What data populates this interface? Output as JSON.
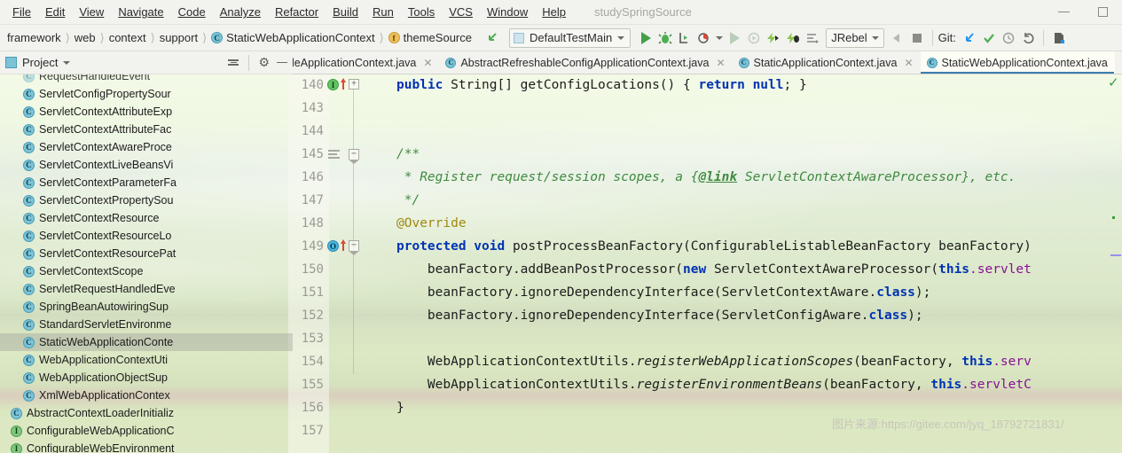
{
  "window": {
    "title": "studySpringSource",
    "minimize_icon": "minimize-icon",
    "maximize_icon": "maximize-icon"
  },
  "menubar": {
    "items": [
      {
        "label": "File"
      },
      {
        "label": "Edit"
      },
      {
        "label": "View"
      },
      {
        "label": "Navigate"
      },
      {
        "label": "Code"
      },
      {
        "label": "Analyze"
      },
      {
        "label": "Refactor"
      },
      {
        "label": "Build"
      },
      {
        "label": "Run"
      },
      {
        "label": "Tools"
      },
      {
        "label": "VCS"
      },
      {
        "label": "Window"
      },
      {
        "label": "Help"
      }
    ]
  },
  "breadcrumbs": {
    "items": [
      {
        "label": "framework",
        "icon": ""
      },
      {
        "label": "web",
        "icon": ""
      },
      {
        "label": "context",
        "icon": ""
      },
      {
        "label": "support",
        "icon": ""
      },
      {
        "label": "StaticWebApplicationContext",
        "icon": "class-icon",
        "glyph": "C"
      },
      {
        "label": "themeSource",
        "icon": "field-icon",
        "glyph": "f"
      }
    ],
    "separator": "〉"
  },
  "toolbar": {
    "back_icon": "back-arrow-icon",
    "run_config": {
      "label": "DefaultTestMain",
      "chip_icon": "run-config-icon",
      "caret_icon": "chevron-down-icon"
    },
    "run_icon": "run-icon",
    "debug_icon": "debug-icon",
    "run_coverage_icon": "run-with-coverage-icon",
    "profile_icon": "profile-icon",
    "profile_caret_icon": "chevron-down-icon",
    "rerun_icon": "rerun-icon",
    "attach_icon": "attach-debugger-icon",
    "jrebel_run_icon": "jrebel-run-icon",
    "jrebel_debug_icon": "jrebel-debug-icon",
    "jrebel_console_icon": "jrebel-console-icon",
    "jrebel": {
      "label": "JRebel",
      "caret_icon": "chevron-down-icon"
    },
    "stop_gradient_icon": "stop-soft-icon",
    "stop_icon": "stop-icon",
    "git": {
      "label": "Git:",
      "update_icon": "update-project-icon",
      "commit_icon": "commit-icon",
      "history_icon": "history-icon",
      "rollback_icon": "rollback-icon",
      "branch_icon": "branch-icon"
    }
  },
  "editor_tabs": [
    {
      "label": "leApplicationContext.java",
      "icon": "class-icon",
      "glyph": "C",
      "active": false,
      "close_icon": "close-icon"
    },
    {
      "label": "AbstractRefreshableConfigApplicationContext.java",
      "icon": "class-icon",
      "glyph": "C",
      "active": false,
      "close_icon": "close-icon"
    },
    {
      "label": "StaticApplicationContext.java",
      "icon": "class-icon",
      "glyph": "C",
      "active": false,
      "close_icon": "close-icon"
    },
    {
      "label": "StaticWebApplicationContext.java",
      "icon": "class-icon",
      "glyph": "C",
      "active": true,
      "close_icon": "close-icon"
    }
  ],
  "project_panel": {
    "title": "Project",
    "caret_icon": "chevron-down-icon",
    "panel_icon": "project-panel-icon",
    "collapse_all_icon": "collapse-all-icon",
    "settings_icon": "gear-icon",
    "hide_icon": "hide-panel-icon",
    "tree": [
      {
        "label": "RequestHandledEvent",
        "kind": "class",
        "glyph": "C",
        "selected": false,
        "partial": true
      },
      {
        "label": "ServletConfigPropertySour",
        "kind": "class",
        "glyph": "C",
        "selected": false
      },
      {
        "label": "ServletContextAttributeExp",
        "kind": "class",
        "glyph": "C",
        "selected": false
      },
      {
        "label": "ServletContextAttributeFac",
        "kind": "class",
        "glyph": "C",
        "selected": false
      },
      {
        "label": "ServletContextAwareProce",
        "kind": "class",
        "glyph": "C",
        "selected": false
      },
      {
        "label": "ServletContextLiveBeansVi",
        "kind": "class",
        "glyph": "C",
        "selected": false
      },
      {
        "label": "ServletContextParameterFa",
        "kind": "class",
        "glyph": "C",
        "selected": false
      },
      {
        "label": "ServletContextPropertySou",
        "kind": "class",
        "glyph": "C",
        "selected": false
      },
      {
        "label": "ServletContextResource",
        "kind": "class",
        "glyph": "C",
        "selected": false
      },
      {
        "label": "ServletContextResourceLo",
        "kind": "class",
        "glyph": "C",
        "selected": false
      },
      {
        "label": "ServletContextResourcePat",
        "kind": "class",
        "glyph": "C",
        "selected": false
      },
      {
        "label": "ServletContextScope",
        "kind": "class",
        "glyph": "C",
        "selected": false
      },
      {
        "label": "ServletRequestHandledEve",
        "kind": "class",
        "glyph": "C",
        "selected": false
      },
      {
        "label": "SpringBeanAutowiringSup",
        "kind": "class",
        "glyph": "C",
        "selected": false
      },
      {
        "label": "StandardServletEnvironme",
        "kind": "class",
        "glyph": "C",
        "selected": false
      },
      {
        "label": "StaticWebApplicationConte",
        "kind": "class",
        "glyph": "C",
        "selected": true
      },
      {
        "label": "WebApplicationContextUti",
        "kind": "class",
        "glyph": "C",
        "selected": false
      },
      {
        "label": "WebApplicationObjectSup",
        "kind": "class",
        "glyph": "C",
        "selected": false
      },
      {
        "label": "XmlWebApplicationContex",
        "kind": "class",
        "glyph": "C",
        "selected": false
      },
      {
        "label": "AbstractContextLoaderInitializ",
        "kind": "class",
        "glyph": "C",
        "selected": false,
        "outdent": true
      },
      {
        "label": "ConfigurableWebApplicationC",
        "kind": "interface",
        "glyph": "I",
        "selected": false,
        "outdent": true
      },
      {
        "label": "ConfigurableWebEnvironment",
        "kind": "interface",
        "glyph": "I",
        "selected": false,
        "outdent": true
      }
    ]
  },
  "editor": {
    "line_numbers": [
      "140",
      "143",
      "144",
      "145",
      "146",
      "147",
      "148",
      "149",
      "150",
      "151",
      "152",
      "153",
      "154",
      "155",
      "156",
      "157"
    ],
    "gutter_markers": [
      {
        "line": "140",
        "icon": "implementing-method-icon",
        "glyph": "I",
        "arrow_icon": "up-arrow-icon"
      },
      {
        "line": "149",
        "icon": "overriding-method-icon",
        "glyph": "O",
        "arrow_icon": "up-arrow-icon"
      },
      {
        "line": "145",
        "icon": "javadoc-icon"
      }
    ],
    "fold_handles": [
      {
        "line": "140",
        "state": "collapsed",
        "glyph": "+"
      },
      {
        "line": "145",
        "state": "expanded",
        "glyph": "−"
      },
      {
        "line": "149",
        "state": "expanded",
        "glyph": "−"
      }
    ],
    "lines": [
      {
        "num": "140",
        "segments": [
          {
            "t": "public ",
            "c": "k"
          },
          {
            "t": "String[] getConfigLocations() { ",
            "c": ""
          },
          {
            "t": "return ",
            "c": "k"
          },
          {
            "t": "null",
            "c": "k"
          },
          {
            "t": "; }",
            "c": ""
          }
        ]
      },
      {
        "num": "143",
        "segments": []
      },
      {
        "num": "144",
        "segments": []
      },
      {
        "num": "145",
        "segments": [
          {
            "t": "/**",
            "c": "cm"
          }
        ]
      },
      {
        "num": "146",
        "segments": [
          {
            "t": " * Register request/session scopes, a {",
            "c": "cm"
          },
          {
            "t": "@link",
            "c": "lnk"
          },
          {
            "t": " ServletContextAwareProcessor}, etc.",
            "c": "cm"
          }
        ]
      },
      {
        "num": "147",
        "segments": [
          {
            "t": " */",
            "c": "cm"
          }
        ]
      },
      {
        "num": "148",
        "segments": [
          {
            "t": "@Override",
            "c": "ann"
          }
        ]
      },
      {
        "num": "149",
        "segments": [
          {
            "t": "protected void ",
            "c": "k"
          },
          {
            "t": "postProcessBeanFactory(ConfigurableListableBeanFactory beanFactory)",
            "c": ""
          }
        ]
      },
      {
        "num": "150",
        "segments": [
          {
            "t": "    beanFactory.addBeanPostProcessor(",
            "c": ""
          },
          {
            "t": "new ",
            "c": "k"
          },
          {
            "t": "ServletContextAwareProcessor(",
            "c": ""
          },
          {
            "t": "this",
            "c": "k"
          },
          {
            "t": ".servlet",
            "c": "fld"
          }
        ]
      },
      {
        "num": "151",
        "segments": [
          {
            "t": "    beanFactory.ignoreDependencyInterface(ServletContextAware.",
            "c": ""
          },
          {
            "t": "class",
            "c": "k"
          },
          {
            "t": ");",
            "c": ""
          }
        ]
      },
      {
        "num": "152",
        "segments": [
          {
            "t": "    beanFactory.ignoreDependencyInterface(ServletConfigAware.",
            "c": ""
          },
          {
            "t": "class",
            "c": "k"
          },
          {
            "t": ");",
            "c": ""
          }
        ]
      },
      {
        "num": "153",
        "segments": []
      },
      {
        "num": "154",
        "segments": [
          {
            "t": "    WebApplicationContextUtils.",
            "c": ""
          },
          {
            "t": "registerWebApplicationScopes",
            "c": "st"
          },
          {
            "t": "(beanFactory, ",
            "c": ""
          },
          {
            "t": "this",
            "c": "k"
          },
          {
            "t": ".serv",
            "c": "fld"
          }
        ]
      },
      {
        "num": "155",
        "segments": [
          {
            "t": "    WebApplicationContextUtils.",
            "c": ""
          },
          {
            "t": "registerEnvironmentBeans",
            "c": "st"
          },
          {
            "t": "(beanFactory, ",
            "c": ""
          },
          {
            "t": "this",
            "c": "k"
          },
          {
            "t": ".servletC",
            "c": "fld"
          }
        ]
      },
      {
        "num": "156",
        "segments": [
          {
            "t": "}",
            "c": ""
          }
        ]
      },
      {
        "num": "157",
        "segments": []
      }
    ],
    "inspection_status_icon": "inspection-ok-icon",
    "inspection_status_glyph": "✓"
  },
  "watermark": {
    "text": "图片来源:https://gitee.com/jyq_18792721831/"
  },
  "colors": {
    "keyword": "#0033b3",
    "comment": "#3f8a3f",
    "annotation": "#9e880d",
    "field": "#871094",
    "accent": "#3c7fb1",
    "run_green": "#43a047"
  }
}
